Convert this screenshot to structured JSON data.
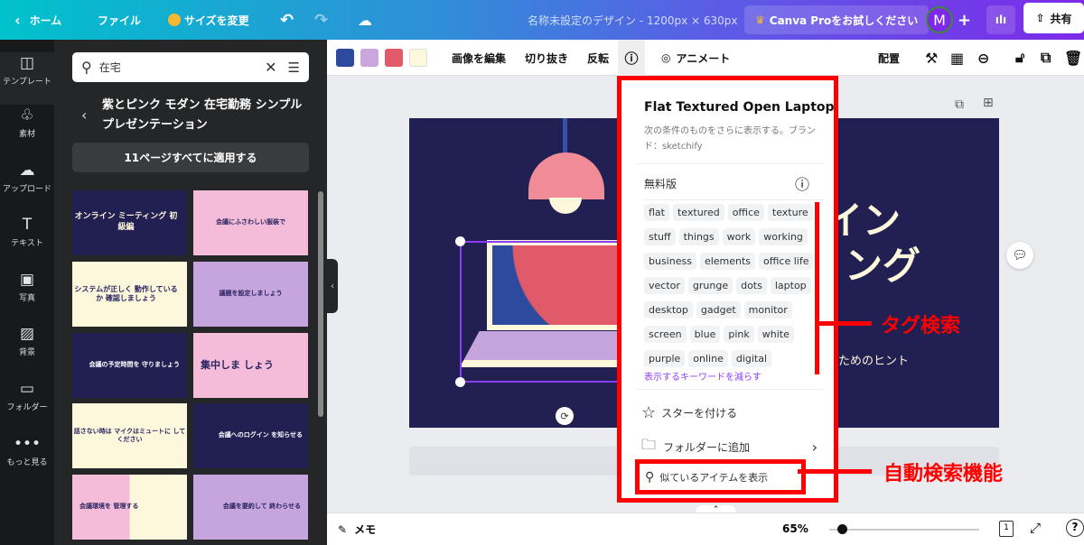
{
  "topbar": {
    "home": "ホーム",
    "file": "ファイル",
    "resize": "サイズを変更",
    "doc_title": "名称未設定のデザイン - 1200px × 630px",
    "pro": "Canva Proをお試しください",
    "avatar": "M",
    "share": "共有"
  },
  "rail": {
    "items": [
      {
        "label": "テンプレート",
        "icon": "template-icon"
      },
      {
        "label": "素材",
        "icon": "elements-icon"
      },
      {
        "label": "アップロード",
        "icon": "upload-icon"
      },
      {
        "label": "テキスト",
        "icon": "text-icon"
      },
      {
        "label": "写真",
        "icon": "photo-icon"
      },
      {
        "label": "背景",
        "icon": "background-icon"
      },
      {
        "label": "フォルダー",
        "icon": "folder-icon"
      },
      {
        "label": "もっと見る",
        "icon": "more-icon"
      }
    ]
  },
  "panel": {
    "search_value": "在宅",
    "template_title": "紫とピンク モダン 在宅勤務 シンプル プレゼンテーション",
    "apply_all": "11ページすべてに適用する",
    "thumbs": [
      "オンライン ミーティング 初級編",
      "会議にふさわしい服装で",
      "システムが正しく 動作しているか 確認しましょう",
      "議題を設定しましょう",
      "会議の予定時間を 守りましょう",
      "集中しま しょう",
      "話さない時は マイクはミュートに してください",
      "会議へのログイン を知らせる",
      "会議環境を 管理する",
      "会議を要約して 終わらせる"
    ]
  },
  "toolbar": {
    "colors": [
      "#2e4a9e",
      "#c9a6dc",
      "#e05a6a",
      "#fdf7dc"
    ],
    "edit_image": "画像を編集",
    "crop": "切り抜き",
    "flip": "反転",
    "animate": "アニメート",
    "position": "配置"
  },
  "slide": {
    "title1": "イン",
    "title2": "ィング",
    "subtitle": "ためのヒント"
  },
  "popup": {
    "title": "Flat Textured Open Laptop",
    "desc": "次の条件のものをさらに表示する。ブランド：sketchify",
    "license": "無料版",
    "tags": [
      "flat",
      "textured",
      "office",
      "texture",
      "stuff",
      "things",
      "work",
      "working",
      "business",
      "elements",
      "office life",
      "vector",
      "grunge",
      "dots",
      "laptop",
      "desktop",
      "gadget",
      "monitor",
      "screen",
      "blue",
      "pink",
      "white",
      "purple",
      "online",
      "digital"
    ],
    "fewer": "表示するキーワードを減らす",
    "star": "スターを付ける",
    "add_folder": "フォルダーに追加",
    "similar": "似ているアイテムを表示"
  },
  "annotations": {
    "tag_search": "タグ検索",
    "auto_search": "自動検索機能"
  },
  "bottombar": {
    "notes": "メモ",
    "zoom": "65%",
    "zoom_level": 65,
    "page": "1"
  }
}
